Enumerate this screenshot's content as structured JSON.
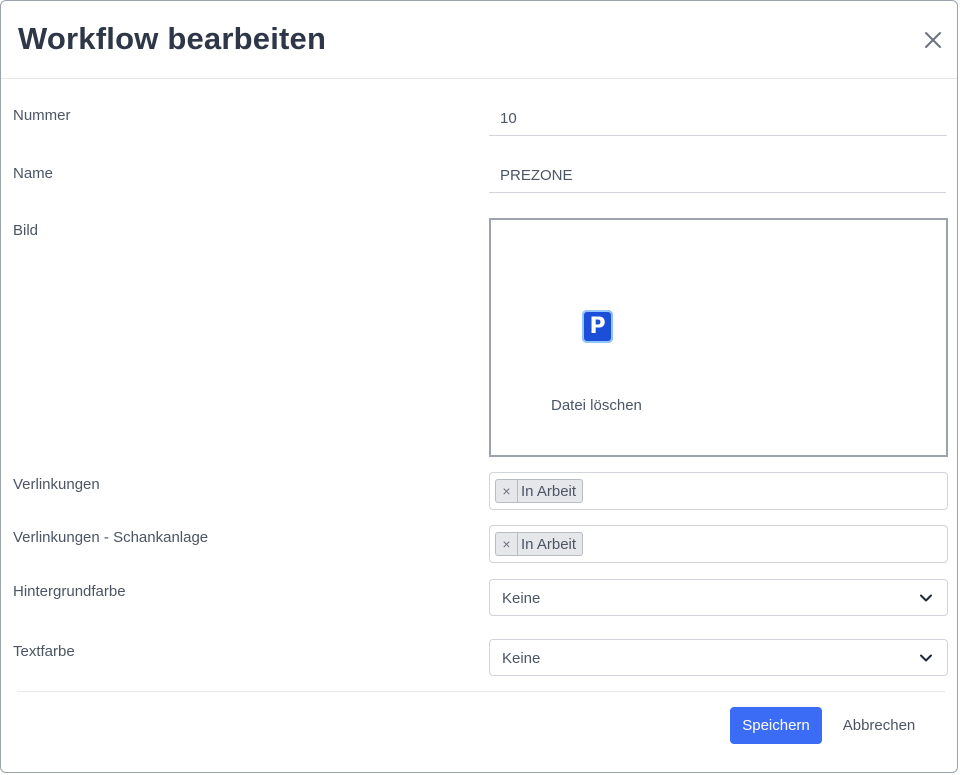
{
  "modal": {
    "title": "Workflow bearbeiten",
    "close_icon": "close-icon"
  },
  "fields": {
    "nummer": {
      "label": "Nummer",
      "value": "10"
    },
    "name": {
      "label": "Name",
      "value": "PREZONE"
    },
    "bild": {
      "label": "Bild",
      "icon": "parking-icon",
      "icon_glyph": "P",
      "delete_label": "Datei löschen"
    },
    "verlinkungen": {
      "label": "Verlinkungen",
      "tags": [
        "In Arbeit"
      ]
    },
    "verlinkungen_schankanlage": {
      "label": "Verlinkungen - Schankanlage",
      "tags": [
        "In Arbeit"
      ]
    },
    "hintergrundfarbe": {
      "label": "Hintergrundfarbe",
      "value": "Keine"
    },
    "textfarbe": {
      "label": "Textfarbe",
      "value": "Keine"
    }
  },
  "tag_remove_symbol": "×",
  "footer": {
    "save_label": "Speichern",
    "cancel_label": "Abbrechen"
  },
  "colors": {
    "primary": "#3b6cf6",
    "title": "#2d3748",
    "parking_icon": "#1d4ed8"
  }
}
